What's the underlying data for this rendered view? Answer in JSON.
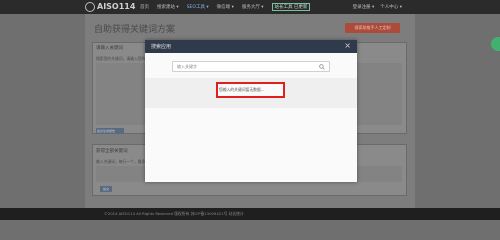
{
  "header": {
    "logo_text": "AISO114",
    "nav": [
      "首页",
      "搜索建站 ▾",
      "SEO工具 ▾",
      "微信端 ▾",
      "服务大厅 ▾"
    ],
    "nav_button": "站长工具 已更新",
    "right": [
      "登录注册 ▾",
      "个人中心 ▾"
    ]
  },
  "page": {
    "title": "自助获得关键词方案",
    "orange_button": "搜索助推手人工定制",
    "section1_label": "请输入关键词",
    "section1_hint": "搜索您的关键词，请输入您的网站，我们会为您提供完整...",
    "section1_button": "提交生成报告",
    "section2_label": "获得全部关键词",
    "section2_hint": "输入关键词，每行一个，最多10个关键词(1000)",
    "section2_button": "提交"
  },
  "modal": {
    "title": "搜索应用",
    "close": "×",
    "search_placeholder": "输入关键字",
    "empty_message": "您输入的关键词暂无数据..."
  },
  "footer": {
    "text": "©2014 AISO114 All Rights Reserved 版权所有 苏ICP备13009421号 站长统计"
  }
}
